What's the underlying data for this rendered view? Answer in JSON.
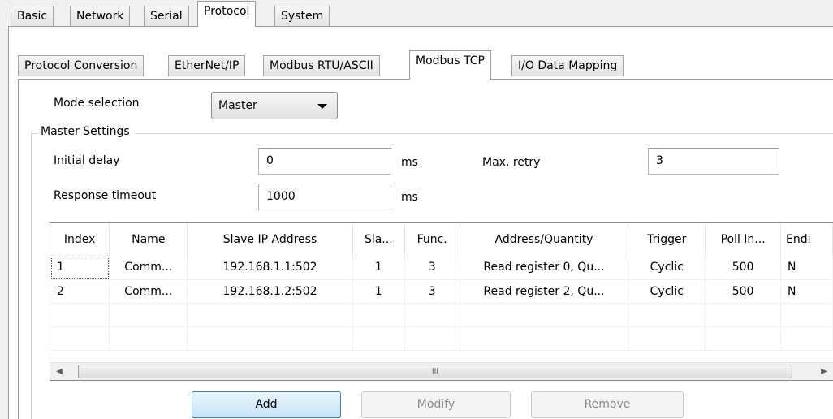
{
  "main_tabs": [
    {
      "label": "Basic",
      "active": false
    },
    {
      "label": "Network",
      "active": false
    },
    {
      "label": "Serial",
      "active": false
    },
    {
      "label": "Protocol",
      "active": true
    },
    {
      "label": "System",
      "active": false
    }
  ],
  "sub_tabs": [
    {
      "label": "Protocol Conversion",
      "active": false
    },
    {
      "label": "EtherNet/IP",
      "active": false
    },
    {
      "label": "Modbus RTU/ASCII",
      "active": false
    },
    {
      "label": "Modbus TCP",
      "active": true
    },
    {
      "label": "I/O Data Mapping",
      "active": false
    }
  ],
  "mode": {
    "label": "Mode selection",
    "value": "Master"
  },
  "master_settings": {
    "title": "Master Settings",
    "initial_delay": {
      "label": "Initial delay",
      "value": "0",
      "unit": "ms"
    },
    "max_retry": {
      "label": "Max. retry",
      "value": "3"
    },
    "response_timeout": {
      "label": "Response timeout",
      "value": "1000",
      "unit": "ms"
    }
  },
  "table": {
    "columns": [
      "Index",
      "Name",
      "Slave IP Address",
      "Sla...",
      "Func.",
      "Address/Quantity",
      "Trigger",
      "Poll In...",
      "Endi"
    ],
    "rows": [
      [
        "1",
        "Comm...",
        "192.168.1.1:502",
        "1",
        "3",
        "Read register 0, Qu...",
        "Cyclic",
        "500",
        "N"
      ],
      [
        "2",
        "Comm...",
        "192.168.1.2:502",
        "1",
        "3",
        "Read register 2, Qu...",
        "Cyclic",
        "500",
        "N"
      ]
    ],
    "scroll_grip": "III"
  },
  "buttons": {
    "add": "Add",
    "modify": "Modify",
    "remove": "Remove"
  }
}
